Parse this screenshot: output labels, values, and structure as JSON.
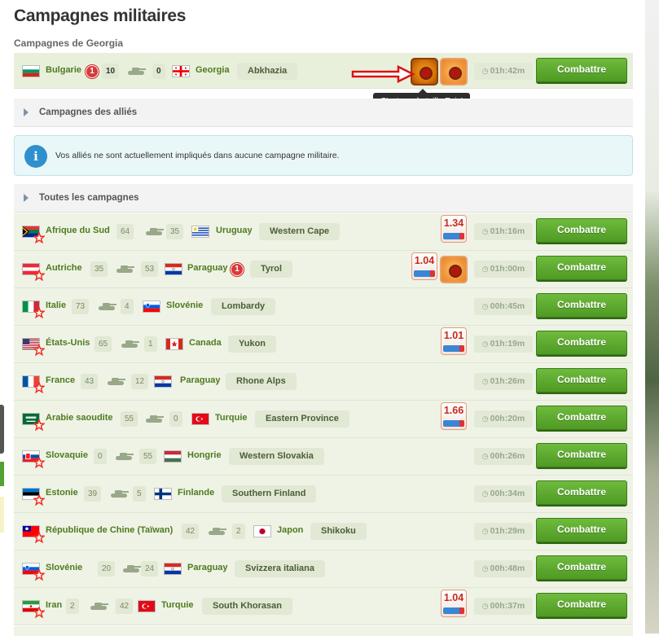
{
  "page": {
    "title": "Campagnes militaires",
    "subtitle": "Campagnes de Georgia"
  },
  "my_campaign": {
    "attacker": "Bulgarie",
    "attacker_badge": "1",
    "attacker_count": "10",
    "defender_count": "0",
    "defender": "Georgia",
    "region": "Abkhazia",
    "time": "01h:42m",
    "button": "Combattre",
    "tooltip": "C'est une bataille Epic!"
  },
  "allies_section": {
    "title": "Campagnes des alliés",
    "info": "Vos alliés ne sont actuellement impliqués dans aucune campagne militaire."
  },
  "all_section": {
    "title": "Toutes les campagnes"
  },
  "colors": {
    "accent_green": "#53a131",
    "country_text": "#4f7a1f",
    "epic_orange": "#f7a11a",
    "info_blue": "#2e90cc"
  },
  "icons": {
    "clock": "clock-icon",
    "tank": "tank-icon",
    "info": "info-icon",
    "arrow": "red-arrow-icon",
    "epic": "epic-battle-icon"
  },
  "rows": [
    {
      "attacker": "Afrique du Sud",
      "attacker_count": "64",
      "defender_count": "35",
      "defender": "Uruguay",
      "region": "Western Cape",
      "boost": "1.34",
      "time": "01h:16m",
      "button": "Combattre"
    },
    {
      "attacker": "Autriche",
      "attacker_count": "35",
      "defender_count": "53",
      "defender": "Paraguay",
      "defender_badge": "1",
      "region": "Tyrol",
      "boost": "1.04",
      "time": "01h:00m",
      "button": "Combattre"
    },
    {
      "attacker": "Italie",
      "attacker_count": "73",
      "defender_count": "4",
      "defender": "Slovénie",
      "region": "Lombardy",
      "time": "00h:45m",
      "button": "Combattre"
    },
    {
      "attacker": "États-Unis",
      "attacker_count": "65",
      "defender_count": "1",
      "defender": "Canada",
      "region": "Yukon",
      "boost": "1.01",
      "time": "01h:19m",
      "button": "Combattre"
    },
    {
      "attacker": "France",
      "attacker_count": "43",
      "defender_count": "12",
      "defender": "Paraguay",
      "region": "Rhone Alps",
      "time": "01h:26m",
      "button": "Combattre"
    },
    {
      "attacker": "Arabie saoudite",
      "attacker_count": "55",
      "defender_count": "0",
      "defender": "Turquie",
      "region": "Eastern Province",
      "boost": "1.66",
      "time": "00h:20m",
      "button": "Combattre"
    },
    {
      "attacker": "Slovaquie",
      "attacker_count": "0",
      "defender_count": "55",
      "defender": "Hongrie",
      "region": "Western Slovakia",
      "time": "00h:26m",
      "button": "Combattre"
    },
    {
      "attacker": "Estonie",
      "attacker_count": "39",
      "defender_count": "5",
      "defender": "Finlande",
      "region": "Southern Finland",
      "time": "00h:34m",
      "button": "Combattre"
    },
    {
      "attacker": "République de Chine (Taïwan)",
      "attacker_count": "42",
      "defender_count": "2",
      "defender": "Japon",
      "region": "Shikoku",
      "time": "01h:29m",
      "button": "Combattre"
    },
    {
      "attacker": "Slovénie",
      "attacker_count": "20",
      "defender_count": "24",
      "defender": "Paraguay",
      "region": "Svizzera italiana",
      "time": "00h:48m",
      "button": "Combattre"
    },
    {
      "attacker": "Iran",
      "attacker_count": "2",
      "defender_count": "42",
      "defender": "Turquie",
      "region": "South Khorasan",
      "boost": "1.04",
      "time": "00h:37m",
      "button": "Combattre"
    }
  ]
}
